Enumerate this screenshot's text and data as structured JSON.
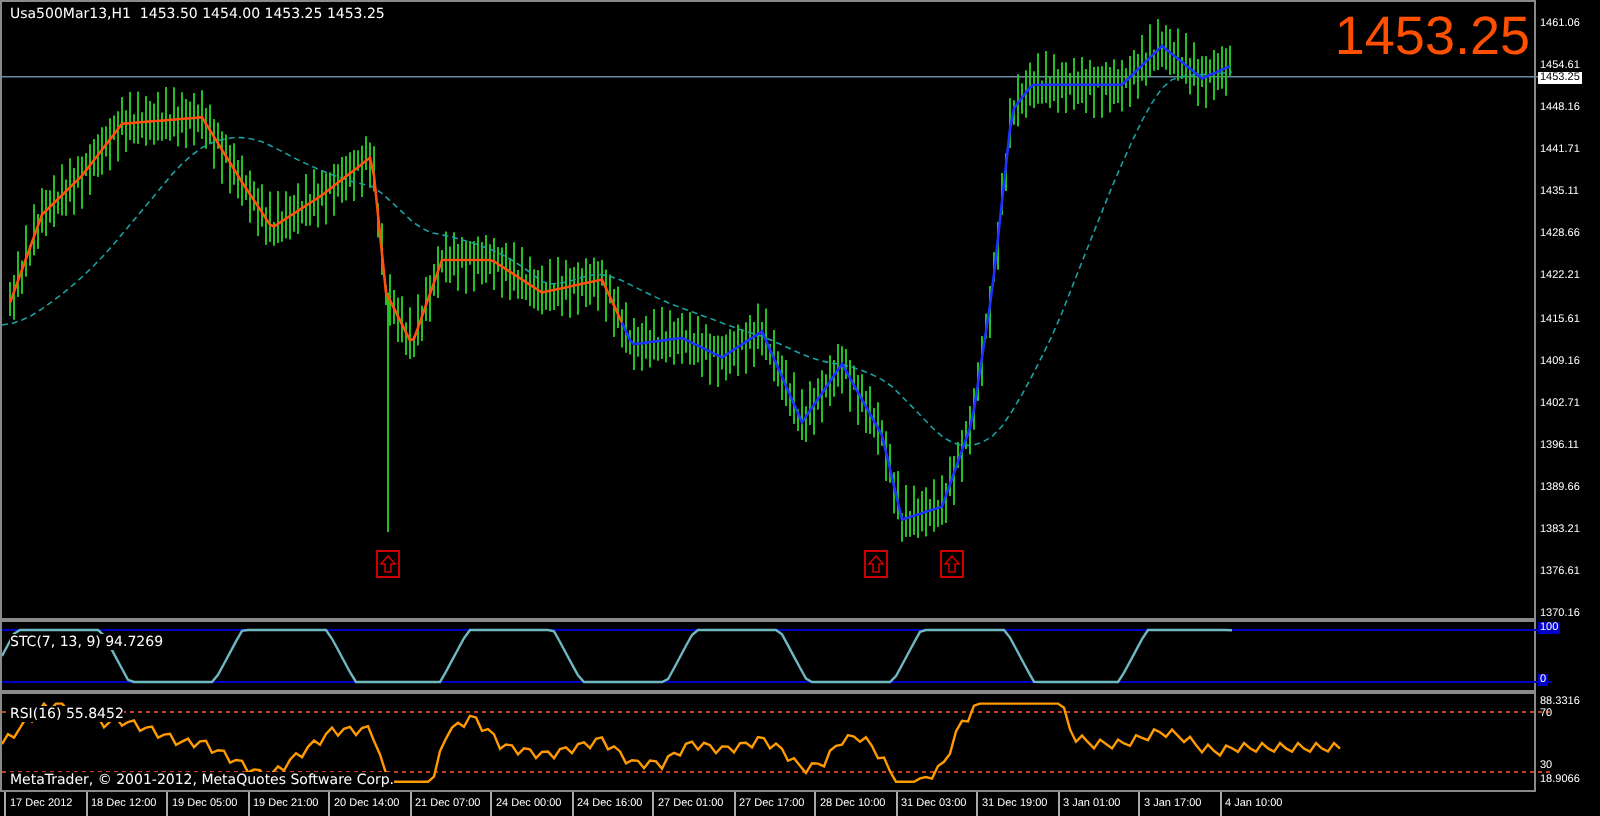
{
  "chart_title": "Usa500Mar13,H1  1453.50 1454.00 1453.25 1453.25",
  "last_price": "1453.25",
  "current_price_label": "1453.25",
  "price_axis": [
    "1461.06",
    "1454.61",
    "1448.16",
    "1441.71",
    "1435.11",
    "1428.66",
    "1422.21",
    "1415.61",
    "1409.16",
    "1402.71",
    "1396.11",
    "1389.66",
    "1383.21",
    "1376.61",
    "1370.16"
  ],
  "stc": {
    "label": "STC(7, 13, 9) 94.7269",
    "axis": [
      "100",
      "0"
    ]
  },
  "rsi": {
    "label": "RSI(16) 55.8452",
    "axis": [
      "88.3316",
      "70",
      "30",
      "18.9066"
    ]
  },
  "copyright": "MetaTrader, © 2001-2012, MetaQuotes Software Corp.",
  "time_axis": [
    "17 Dec 2012",
    "18 Dec 12:00",
    "19 Dec 05:00",
    "19 Dec 21:00",
    "20 Dec 14:00",
    "21 Dec 07:00",
    "24 Dec 00:00",
    "24 Dec 16:00",
    "27 Dec 01:00",
    "27 Dec 17:00",
    "28 Dec 10:00",
    "31 Dec 03:00",
    "31 Dec 19:00",
    "3 Jan 01:00",
    "3 Jan 17:00",
    "4 Jan 10:00"
  ]
}
